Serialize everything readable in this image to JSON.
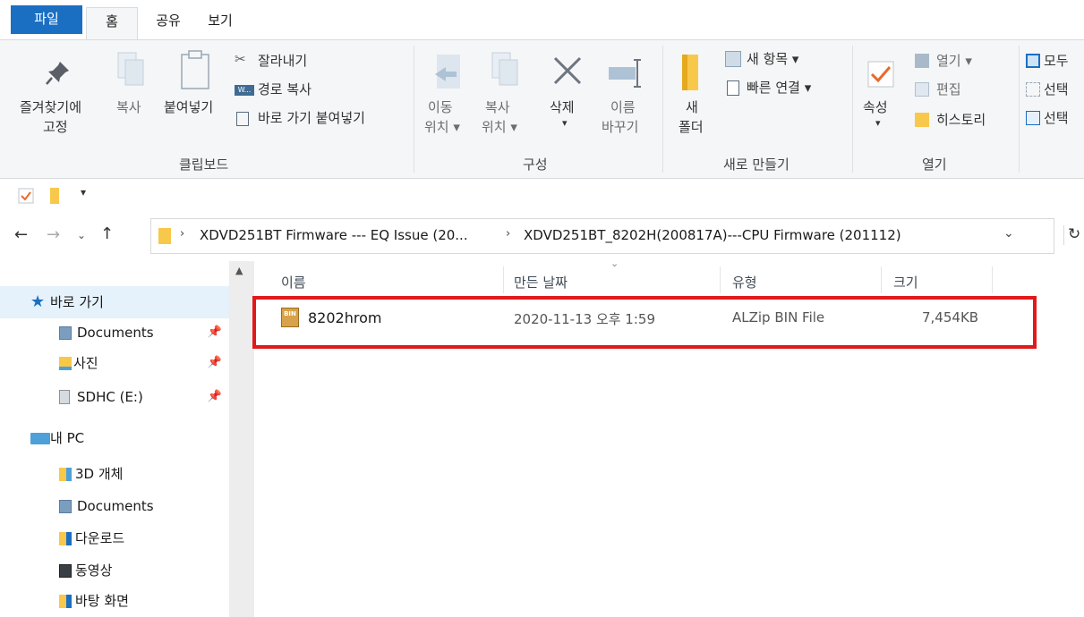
{
  "tabs": {
    "file": "파일",
    "home": "홈",
    "share": "공유",
    "view": "보기"
  },
  "ribbon": {
    "pin_quick_access": [
      "즐겨찾기에",
      "고정"
    ],
    "copy": "복사",
    "paste": "붙여넣기",
    "cut": "잘라내기",
    "copy_path": "경로 복사",
    "paste_shortcut": "바로 가기 붙여넣기",
    "clipboard_group": "클립보드",
    "move_to": [
      "이동",
      "위치 ▾"
    ],
    "copy_to": [
      "복사",
      "위치 ▾"
    ],
    "delete": [
      "삭제",
      "▾"
    ],
    "rename": [
      "이름",
      "바꾸기"
    ],
    "organize_group": "구성",
    "new_folder": [
      "새",
      "폴더"
    ],
    "new_item": "새 항목 ▾",
    "easy_access": "빠른 연결 ▾",
    "new_group": "새로 만들기",
    "properties": [
      "속성",
      "▾"
    ],
    "open": "열기 ▾",
    "edit": "편집",
    "history": "히스토리",
    "open_group": "열기",
    "select_all": "모두",
    "select_none": "선택",
    "invert_selection": "선택"
  },
  "address": {
    "crumb1": "XDVD251BT Firmware --- EQ Issue (20...",
    "crumb2": "XDVD251BT_8202H(200817A)---CPU Firmware (201112)"
  },
  "nav": {
    "quick_access": "바로 가기",
    "documents": "Documents",
    "pictures": "사진",
    "sdhc": "SDHC (E:)",
    "this_pc": "내 PC",
    "objects3d": "3D 개체",
    "documents2": "Documents",
    "downloads": "다운로드",
    "videos": "동영상",
    "desktop": "바탕 화면"
  },
  "columns": {
    "name": "이름",
    "date": "만든 날짜",
    "type": "유형",
    "size": "크기"
  },
  "files": [
    {
      "name": "8202hrom",
      "date": "2020-11-13 오후 1:59",
      "type": "ALZip BIN File",
      "size": "7,454KB",
      "icon_label": "BIN"
    }
  ],
  "colors": {
    "accent": "#1a6fc2",
    "highlight": "#e0191a",
    "folder": "#f8c84a",
    "selection": "#e5f1fb"
  }
}
